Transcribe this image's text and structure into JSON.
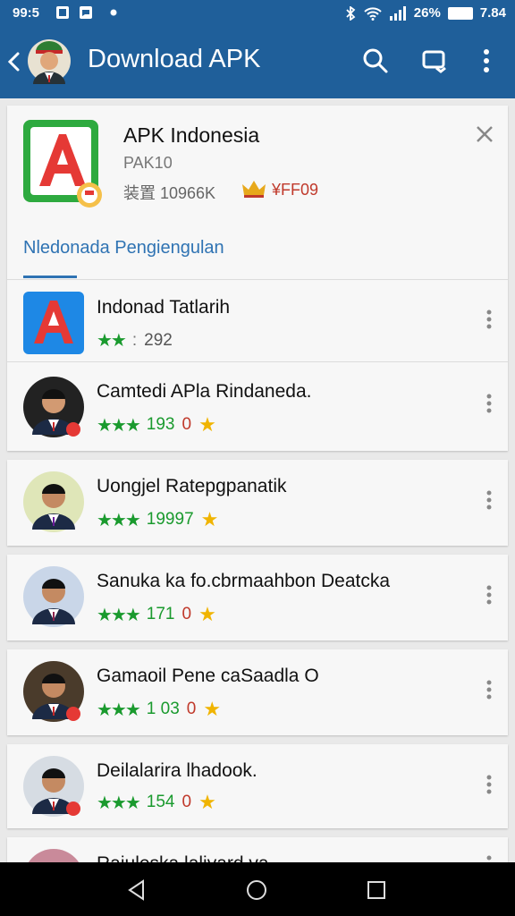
{
  "status_bar": {
    "time": "99:5",
    "battery_percent": "26%",
    "clock_right": "7.84"
  },
  "app_bar": {
    "title": "Download APK",
    "icons": [
      "back-icon",
      "avatar",
      "search-icon",
      "cast-icon",
      "more-vert-icon"
    ]
  },
  "featured_app": {
    "name": "APK Indonesia",
    "code": "PAK10",
    "size": "装置 10966K",
    "badge": "¥FF09"
  },
  "tab": {
    "label": "Nledonada Pengiengulan"
  },
  "list": [
    {
      "name": "Indonad Tatlarih",
      "stars": "★★",
      "rating": "292",
      "zero": "",
      "gold_star": "",
      "thumb": "apk-logo"
    },
    {
      "name": "Camtedi APla Rindaneda.",
      "stars": "★★★",
      "rating": "193",
      "zero": "0",
      "gold_star": "★",
      "thumb": "person"
    },
    {
      "name": "Uongjel Ratepgpanatik",
      "stars": "★★★",
      "rating": "19997",
      "zero": "",
      "gold_star": "★",
      "thumb": "person"
    },
    {
      "name": "Sanuka ka fo.cbrmaahbon Deatcka",
      "stars": "★★★",
      "rating": "171",
      "zero": "0",
      "gold_star": "★",
      "thumb": "person"
    },
    {
      "name": "Gamaoil Pene caSaadla O",
      "stars": "★★★",
      "rating": "1 03",
      "zero": "0",
      "gold_star": "★",
      "thumb": "person"
    },
    {
      "name": "Deilalarira lhadook.",
      "stars": "★★★",
      "rating": "154",
      "zero": "0",
      "gold_star": "★",
      "thumb": "person"
    },
    {
      "name": "Rajuleska lalivard va",
      "stars": "",
      "rating": "",
      "zero": "",
      "gold_star": "",
      "thumb": "person"
    }
  ],
  "colors": {
    "primary": "#1f5f9a",
    "accent": "#2f73b3",
    "rating_green": "#1a9a2e",
    "gold": "#f0b400",
    "red": "#c0392b"
  }
}
